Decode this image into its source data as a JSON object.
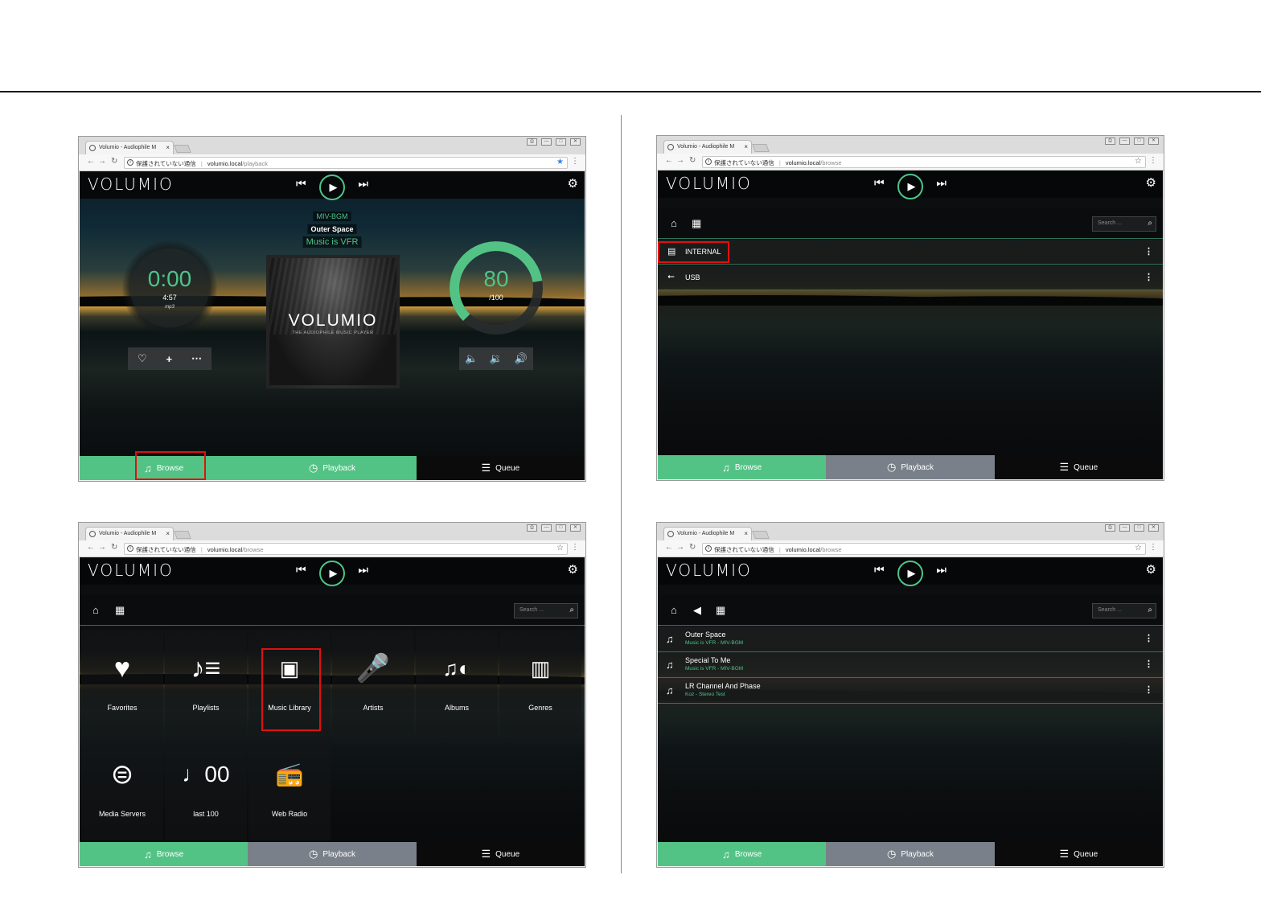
{
  "browser": {
    "tab_title": "Volumio - Audiophile M",
    "tab_close": "×",
    "not_secure": "保護されていない通信",
    "host": "volumio.local",
    "window_controls": [
      "⎙",
      "—",
      "□",
      "✕"
    ]
  },
  "app": {
    "logo": "VOLUMIO",
    "footer": {
      "browse": "Browse",
      "playback": "Playback",
      "queue": "Queue"
    },
    "search_placeholder": "Search ...",
    "colors": {
      "accent": "#53c385",
      "inactive_tab": "#7a8089",
      "highlight_box": "#e01010"
    }
  },
  "screen1": {
    "path": "/playback",
    "artist": "MIV-BGM",
    "title": "Outer Space",
    "album": "Music is VFR",
    "album_art_logo": "VOLUMIO",
    "album_art_sub": "THE AUDIOPHILE MUSIC PLAYER",
    "elapsed": "0:00",
    "duration": "4:57",
    "format": "mp3",
    "volume": "80",
    "volume_max": "/100",
    "volume_fraction": 0.8
  },
  "screen2": {
    "path": "/browse",
    "sources": [
      {
        "icon": "hard-drive-icon",
        "label": "INTERNAL"
      },
      {
        "icon": "usb-icon",
        "label": "USB"
      }
    ]
  },
  "screen3": {
    "path": "/browse",
    "tiles": [
      {
        "icon": "heart-icon",
        "label": "Favorites"
      },
      {
        "icon": "playlist-icon",
        "label": "Playlists"
      },
      {
        "icon": "music-library-icon",
        "label": "Music Library"
      },
      {
        "icon": "microphone-icon",
        "label": "Artists"
      },
      {
        "icon": "album-icon",
        "label": "Albums"
      },
      {
        "icon": "genres-icon",
        "label": "Genres"
      },
      {
        "icon": "media-server-icon",
        "label": "Media Servers"
      },
      {
        "icon": "last-100-icon",
        "label": "last 100"
      },
      {
        "icon": "radio-icon",
        "label": "Web Radio"
      }
    ]
  },
  "screen4": {
    "path": "/browse",
    "tracks": [
      {
        "title": "Outer Space",
        "subtitle": "Music is VFR - MIV-BGM"
      },
      {
        "title": "Special To Me",
        "subtitle": "Music is VFR - MIV-BGM"
      },
      {
        "title": "LR Channel And Phase",
        "subtitle": "Koz - Stereo Test"
      }
    ]
  }
}
